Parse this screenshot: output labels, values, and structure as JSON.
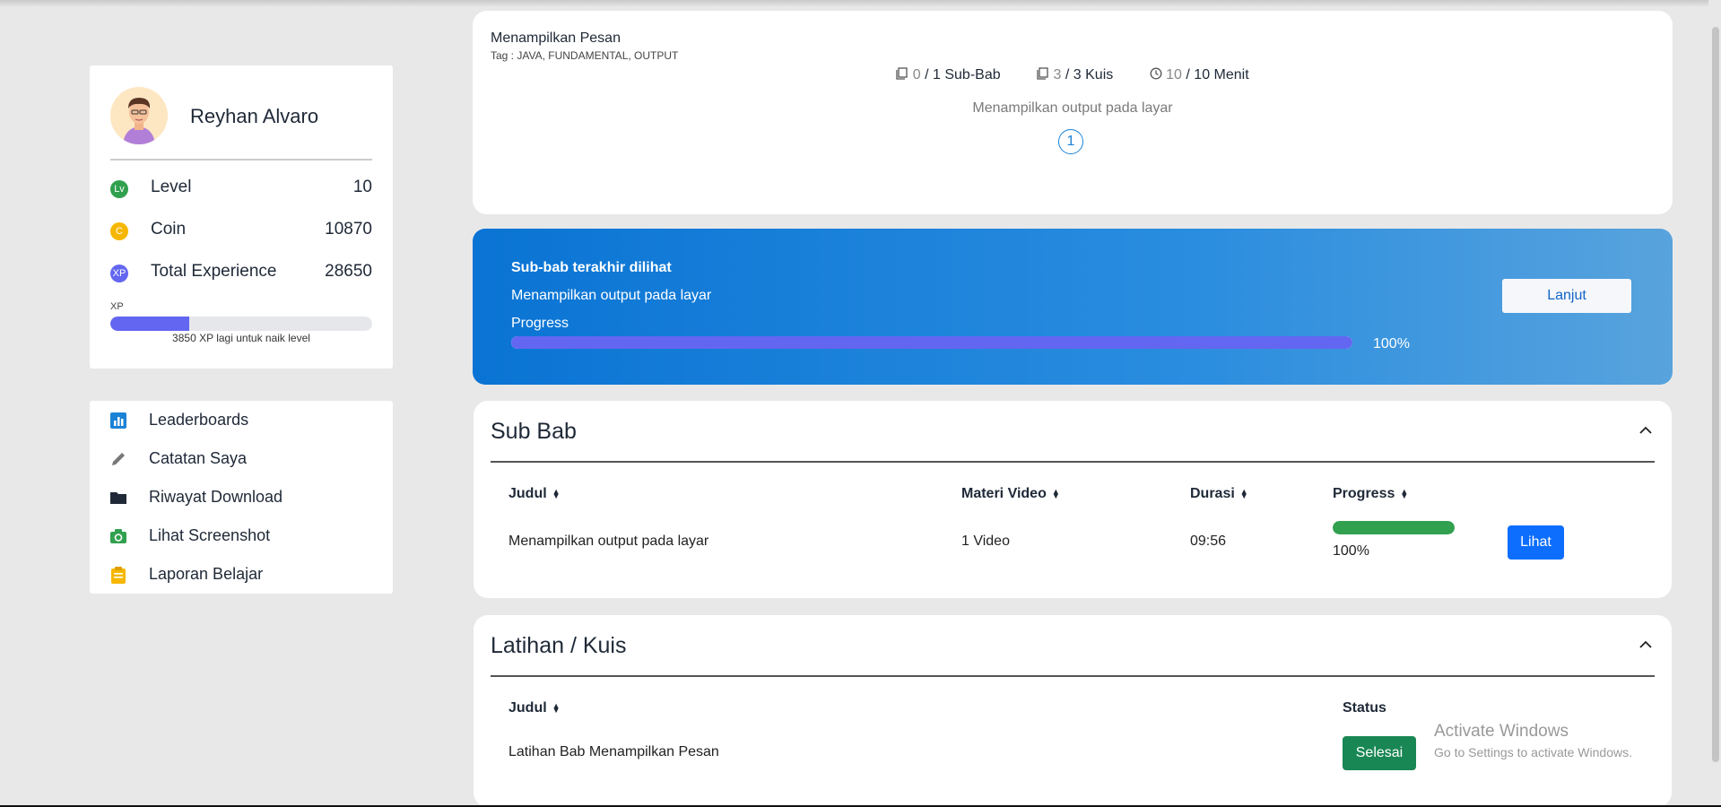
{
  "profile": {
    "name": "Reyhan Alvaro",
    "level_label": "Level",
    "level_icon": "Lv",
    "level_value": "10",
    "coin_label": "Coin",
    "coin_icon": "C",
    "coin_value": "10870",
    "xp_label": "Total Experience",
    "xp_icon": "XP",
    "xp_value": "28650",
    "xp_bar_label": "XP",
    "xp_progress": 0.3,
    "xp_note": "3850 XP lagi untuk naik level"
  },
  "menu": {
    "items": [
      {
        "label": "Leaderboards",
        "icon": "bar-chart-icon",
        "color": "#1b82d6"
      },
      {
        "label": "Catatan Saya",
        "icon": "pencil-icon",
        "color": "#777777"
      },
      {
        "label": "Riwayat Download",
        "icon": "folder-icon",
        "color": "#1f2937"
      },
      {
        "label": "Lihat Screenshot",
        "icon": "camera-icon",
        "color": "#31a04f"
      },
      {
        "label": "Laporan Belajar",
        "icon": "clipboard-icon",
        "color": "#f5b700"
      }
    ]
  },
  "course": {
    "title": "Menampilkan Pesan",
    "tag": "Tag : JAVA, FUNDAMENTAL, OUTPUT",
    "subbab_done": "0",
    "subbab_total": "/ 1 Sub-Bab",
    "kuis_done": "3",
    "kuis_total": "/ 3 Kuis",
    "menit_done": "10",
    "menit_total": "/ 10 Menit",
    "description": "Menampilkan output pada layar",
    "step_number": "1"
  },
  "last_viewed": {
    "title": "Sub-bab terakhir dilihat",
    "subtitle": "Menampilkan output pada layar",
    "progress_label": "Progress",
    "progress": 1.0,
    "progress_text": "100%",
    "button_label": "Lanjut"
  },
  "subbab": {
    "heading": "Sub Bab",
    "columns": {
      "judul": "Judul",
      "materi": "Materi Video",
      "durasi": "Durasi",
      "progress": "Progress"
    },
    "row": {
      "judul": "Menampilkan output pada layar",
      "materi": "1 Video",
      "durasi": "09:56",
      "progress": 1.0,
      "progress_text": "100%",
      "button": "Lihat"
    }
  },
  "latihan": {
    "heading": "Latihan / Kuis",
    "columns": {
      "judul": "Judul",
      "status": "Status"
    },
    "row": {
      "judul": "Latihan Bab Menampilkan Pesan",
      "status": "Selesai"
    }
  },
  "watermark": {
    "line1": "Activate Windows",
    "line2": "Go to Settings to activate Windows."
  },
  "colors": {
    "accent_blue": "#0d6efd",
    "xp_purple": "#6366f1",
    "success_green": "#198754",
    "level_green": "#31a04f",
    "coin_yellow": "#f5b700"
  }
}
